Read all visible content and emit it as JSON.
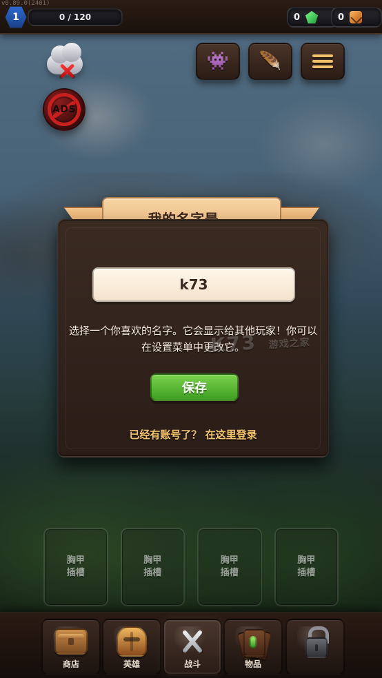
{
  "header": {
    "version": "v0.89.0(2401)",
    "level": "1",
    "xp": "0 / 120",
    "gems": "0",
    "horns": "0"
  },
  "left_icons": {
    "no_ads_text": "ADS"
  },
  "dialog": {
    "title": "我的名字是...",
    "name_value": "k73",
    "description": "选择一个你喜欢的名字。它会显示给其他玩家！你可以在设置菜单中更改它。",
    "save_label": "保存",
    "login_prefix": "已经有账号了？",
    "login_link": "在这里登录"
  },
  "watermark": {
    "main": "K73",
    "sub": "游戏之家"
  },
  "armor_slots": [
    {
      "label_line1": "胸甲",
      "label_line2": "插槽"
    },
    {
      "label_line1": "胸甲",
      "label_line2": "插槽"
    },
    {
      "label_line1": "胸甲",
      "label_line2": "插槽"
    },
    {
      "label_line1": "胸甲",
      "label_line2": "插槽"
    }
  ],
  "bottom_nav": [
    {
      "label": "商店"
    },
    {
      "label": "英雄"
    },
    {
      "label": "战斗"
    },
    {
      "label": "物品"
    },
    {
      "label": ""
    }
  ]
}
